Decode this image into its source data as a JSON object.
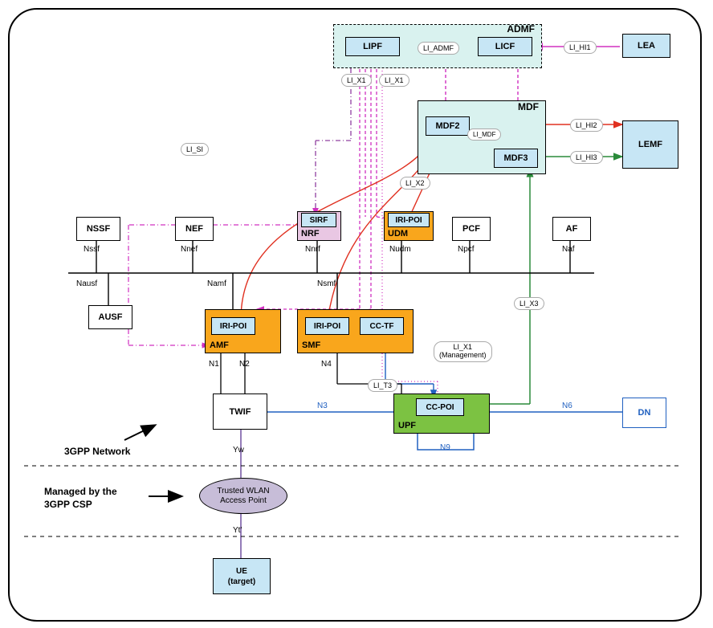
{
  "admf": {
    "title": "ADMF",
    "lipf": "LIPF",
    "licf": "LICF",
    "li_admf": "LI_ADMF"
  },
  "mdf": {
    "title": "MDF",
    "mdf2": "MDF2",
    "mdf3": "MDF3",
    "li_mdf": "LI_MDF"
  },
  "lea": "LEA",
  "lemf": "LEMF",
  "interfaces": {
    "li_hi1": "LI_HI1",
    "li_hi2": "LI_HI2",
    "li_hi3": "LI_HI3",
    "li_x1a": "LI_X1",
    "li_x1b": "LI_X1",
    "li_si": "LI_SI",
    "li_x2": "LI_X2",
    "li_x3": "LI_X3",
    "li_t3": "LI_T3",
    "li_x1_mgmt": "LI_X1\n(Management)"
  },
  "sb_nfs": {
    "nssf": "NSSF",
    "nef": "NEF",
    "nrf": "NRF",
    "udm": "UDM",
    "pcf": "PCF",
    "af": "AF",
    "ausf": "AUSF",
    "amf": "AMF",
    "smf": "SMF"
  },
  "sb_labels": {
    "nssf": "Nssf",
    "nnef": "Nnef",
    "nnrf": "Nnrf",
    "nudm": "Nudm",
    "npcf": "Npcf",
    "naf": "Naf",
    "nausf": "Nausf",
    "namf": "Namf",
    "nsmf": "Nsmf"
  },
  "li_fn": {
    "sirf": "SIRF",
    "iri_poi": "IRI-POI",
    "cc_tf": "CC-TF",
    "cc_poi": "CC-POI"
  },
  "ref": {
    "n1": "N1",
    "n2": "N2",
    "n3": "N3",
    "n4": "N4",
    "n6": "N6",
    "n9": "N9",
    "yw": "Yw",
    "yt": "Yt'"
  },
  "nodes": {
    "twif": "TWIF",
    "upf": "UPF",
    "dn": "DN",
    "twap": "Trusted WLAN\nAccess Point",
    "ue": "UE\n(target)"
  },
  "annotations": {
    "network": "3GPP Network",
    "managed": "Managed by the\n3GPP CSP"
  },
  "chart_data": {
    "type": "diagram",
    "title": "5G LI architecture — trusted WLAN access",
    "groups": [
      {
        "name": "ADMF",
        "contains": [
          "LIPF",
          "LICF"
        ]
      },
      {
        "name": "MDF",
        "contains": [
          "MDF2",
          "MDF3"
        ]
      },
      {
        "name": "NRF",
        "contains": [
          "SIRF"
        ]
      },
      {
        "name": "UDM",
        "contains": [
          "IRI-POI"
        ]
      },
      {
        "name": "AMF",
        "contains": [
          "IRI-POI"
        ]
      },
      {
        "name": "SMF",
        "contains": [
          "IRI-POI",
          "CC-TF"
        ]
      },
      {
        "name": "UPF",
        "contains": [
          "CC-POI"
        ]
      }
    ],
    "service_bus_top": [
      "NSSF",
      "NEF",
      "NRF",
      "UDM",
      "PCF",
      "AF"
    ],
    "service_bus_bottom": [
      "AUSF",
      "AMF",
      "SMF"
    ],
    "service_based_interfaces": [
      "Nssf",
      "Nnef",
      "Nnrf",
      "Nudm",
      "Npcf",
      "Naf",
      "Nausf",
      "Namf",
      "Nsmf"
    ],
    "reference_points": [
      {
        "name": "N1",
        "between": [
          "UE/TWIF",
          "AMF"
        ]
      },
      {
        "name": "N2",
        "between": [
          "TWIF",
          "AMF"
        ]
      },
      {
        "name": "N3",
        "between": [
          "TWIF",
          "UPF"
        ]
      },
      {
        "name": "N4",
        "between": [
          "SMF",
          "UPF"
        ]
      },
      {
        "name": "N6",
        "between": [
          "UPF",
          "DN"
        ]
      },
      {
        "name": "N9",
        "between": [
          "UPF",
          "UPF"
        ]
      },
      {
        "name": "Yw",
        "between": [
          "TWIF",
          "Trusted WLAN Access Point"
        ]
      },
      {
        "name": "Yt'",
        "between": [
          "Trusted WLAN Access Point",
          "UE"
        ]
      }
    ],
    "li_interfaces": [
      {
        "name": "LI_HI1",
        "between": [
          "LICF",
          "LEA"
        ],
        "color": "magenta"
      },
      {
        "name": "LI_ADMF",
        "between": [
          "LIPF",
          "LICF"
        ],
        "color": "magenta"
      },
      {
        "name": "LI_X1",
        "between": [
          "LIPF",
          "POIs (AMF/SMF/UDM IRI-POI, CC-TF, CC-POI)"
        ],
        "color": "magenta-dash"
      },
      {
        "name": "LI_X1",
        "between": [
          "LIPF",
          "MDF2/MDF3"
        ],
        "color": "magenta-dash"
      },
      {
        "name": "LI_SI",
        "between": [
          "LIPF",
          "SIRF"
        ],
        "color": "magenta-dashdot"
      },
      {
        "name": "LI_X1 (Management)",
        "between": [
          "LIPF",
          "UPF"
        ],
        "color": "magenta-dot"
      },
      {
        "name": "LI_MDF",
        "between": [
          "MDF2",
          "MDF3"
        ],
        "color": "red"
      },
      {
        "name": "LI_X2",
        "between": [
          "IRI-POIs",
          "MDF2"
        ],
        "color": "red"
      },
      {
        "name": "LI_X3",
        "between": [
          "CC-POI",
          "MDF3"
        ],
        "color": "green"
      },
      {
        "name": "LI_T3",
        "between": [
          "CC-TF",
          "CC-POI"
        ],
        "color": "blue"
      },
      {
        "name": "LI_HI2",
        "between": [
          "MDF2",
          "LEMF"
        ],
        "color": "red"
      },
      {
        "name": "LI_HI3",
        "between": [
          "MDF3",
          "LEMF"
        ],
        "color": "green"
      }
    ],
    "annotations": [
      "3GPP Network",
      "Managed by the 3GPP CSP"
    ]
  }
}
